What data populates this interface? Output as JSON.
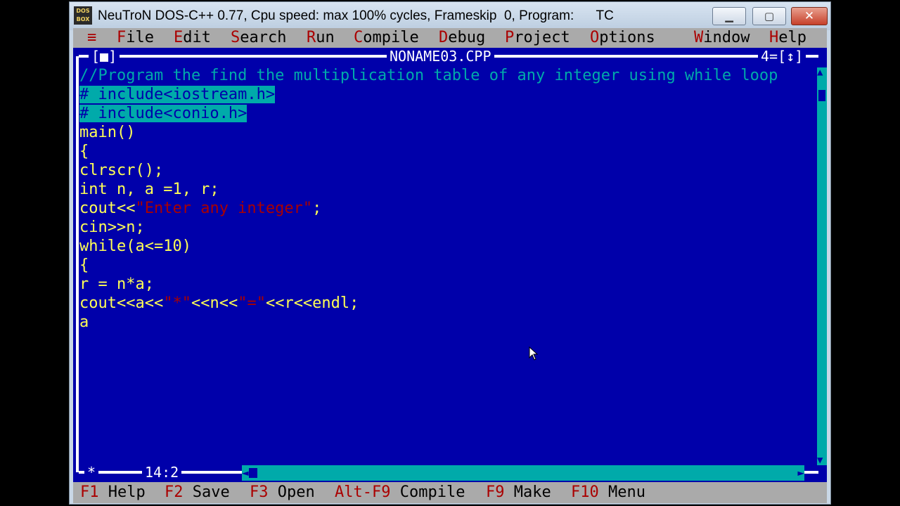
{
  "window": {
    "title": "NeuTroN DOS-C++ 0.77, Cpu speed: max 100% cycles, Frameskip  0, Program:      TC",
    "icon_text_top": "DOS",
    "icon_text_bottom": "BOX",
    "minimize_icon": "minimize-icon",
    "maximize_icon": "maximize-icon",
    "close_icon": "close-icon"
  },
  "menu": {
    "system": "≡",
    "items": [
      {
        "hotkey": "F",
        "rest": "ile"
      },
      {
        "hotkey": "E",
        "rest": "dit"
      },
      {
        "hotkey": "S",
        "rest": "earch"
      },
      {
        "hotkey": "R",
        "rest": "un"
      },
      {
        "hotkey": "C",
        "rest": "ompile"
      },
      {
        "hotkey": "D",
        "rest": "ebug"
      },
      {
        "hotkey": "P",
        "rest": "roject"
      },
      {
        "hotkey": "O",
        "rest": "ptions"
      },
      {
        "hotkey": "W",
        "rest": "indow"
      },
      {
        "hotkey": "H",
        "rest": "elp"
      }
    ]
  },
  "editor_window": {
    "close_box": "[■]",
    "filename": "NONAME03.CPP",
    "window_number": "4=[↕]",
    "cursor_position": "14:2",
    "corner_mark": "*"
  },
  "code": {
    "line1": "//Program the find the multiplication table of any integer using while loop",
    "line2": "# include<iostream.h>",
    "line3": "# include<conio.h>",
    "line4": "main()",
    "line5": "{",
    "line6": "clrscr();",
    "line7": "int n, a =1, r;",
    "line8_a": "cout<<",
    "line8_b": "\"Enter any integer\"",
    "line8_c": ";",
    "line9": "cin>>n;",
    "line10": "while(a<=10)",
    "line11": "{",
    "line12": "r = n*a;",
    "line13_a": "cout<<a<<",
    "line13_b": "\"*\"",
    "line13_c": "<<n<<",
    "line13_d": "\"=\"",
    "line13_e": "<<r<<endl;",
    "line14": "a"
  },
  "statusbar": [
    {
      "key": "F1",
      "label": "Help"
    },
    {
      "key": "F2",
      "label": "Save"
    },
    {
      "key": "F3",
      "label": "Open"
    },
    {
      "key": "Alt-F9",
      "label": "Compile"
    },
    {
      "key": "F9",
      "label": "Make"
    },
    {
      "key": "F10",
      "label": "Menu"
    }
  ],
  "colors": {
    "editor_bg": "#0000aa",
    "code_text": "#ffff55",
    "comment": "#00aaaa",
    "string": "#aa0000",
    "menu_bg": "#aaaaaa",
    "hotkey": "#aa0000"
  }
}
